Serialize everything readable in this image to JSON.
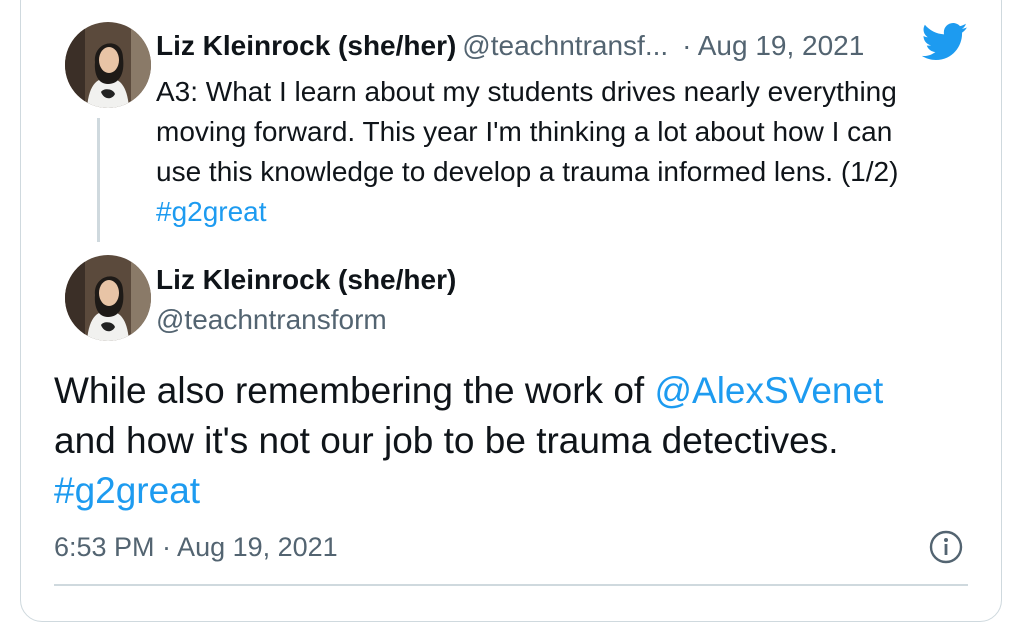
{
  "parent_tweet": {
    "author_name": "Liz Kleinrock (she/her)",
    "author_handle": "@teachntransf...",
    "separator": "·",
    "date": "Aug 19, 2021",
    "text_line1": "A3: What I learn about my students drives nearly everything",
    "text_line2": "moving forward. This year I'm thinking a lot about how I can",
    "text_line3": "use this knowledge to develop a trauma informed lens. (1/2)",
    "hashtag": "#g2great"
  },
  "main_tweet": {
    "author_name": "Liz Kleinrock (she/her)",
    "author_handle": "@teachntransform",
    "text_part1": "While also remembering the work of ",
    "mention": "@AlexSVenet",
    "text_line2": "and how it's not our job to be trauma detectives.",
    "hashtag": "#g2great",
    "timestamp": "6:53 PM · Aug 19, 2021"
  },
  "icons": {
    "logo": "twitter-bird-icon",
    "info": "info-icon"
  },
  "colors": {
    "link": "#1d9bf0",
    "muted": "#536471",
    "border": "#cfd9de",
    "text": "#0f1419"
  }
}
